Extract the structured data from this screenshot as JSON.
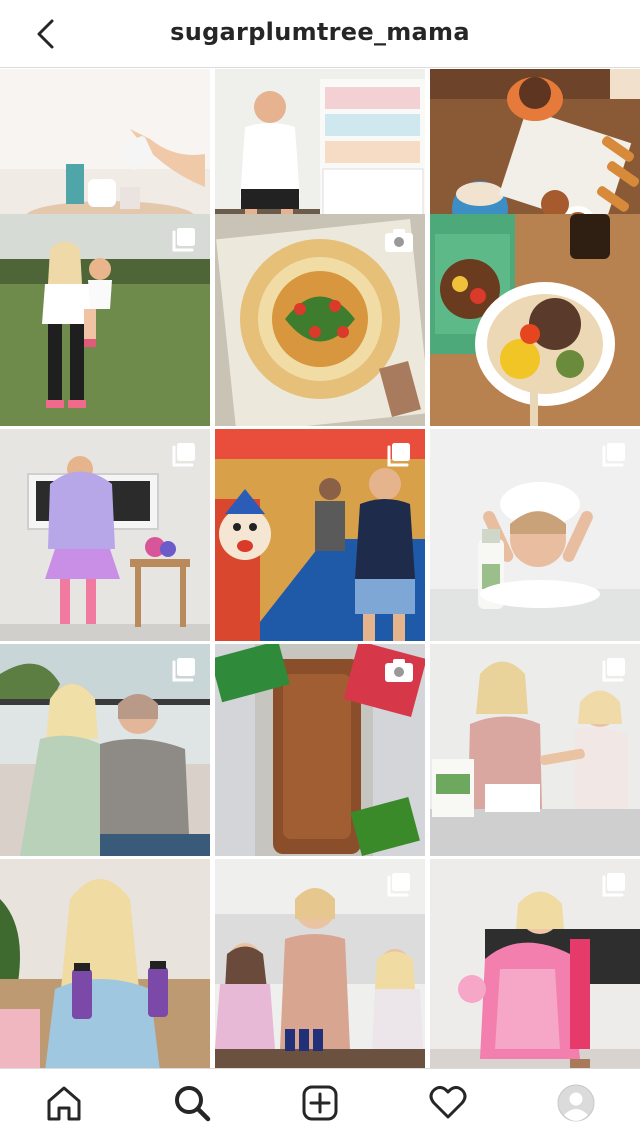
{
  "header": {
    "username": "sugarplumtree_mama",
    "back_icon": "chevron-left-icon"
  },
  "grid": {
    "posts": [
      {
        "id": "p1",
        "scene": "salon",
        "badge": null
      },
      {
        "id": "p2",
        "scene": "nursery",
        "badge": null
      },
      {
        "id": "p3",
        "scene": "cafe",
        "badge": null
      },
      {
        "id": "p4",
        "scene": "park",
        "badge": "carousel"
      },
      {
        "id": "p5",
        "scene": "pizza",
        "badge": "video"
      },
      {
        "id": "p6",
        "scene": "bowl",
        "badge": null
      },
      {
        "id": "p7",
        "scene": "costume",
        "badge": "carousel"
      },
      {
        "id": "p8",
        "scene": "arcade",
        "badge": "carousel"
      },
      {
        "id": "p9",
        "scene": "bath",
        "badge": "carousel"
      },
      {
        "id": "p10",
        "scene": "balcony",
        "badge": "carousel"
      },
      {
        "id": "p11",
        "scene": "board",
        "badge": "video"
      },
      {
        "id": "p12",
        "scene": "kitchen",
        "badge": "carousel"
      },
      {
        "id": "p13",
        "scene": "bottles",
        "badge": null
      },
      {
        "id": "p14",
        "scene": "family",
        "badge": "carousel"
      },
      {
        "id": "p15",
        "scene": "backpack",
        "badge": "carousel"
      }
    ]
  },
  "tabbar": {
    "tabs": [
      {
        "name": "home",
        "icon": "home-icon"
      },
      {
        "name": "search",
        "icon": "search-icon",
        "active": true
      },
      {
        "name": "new-post",
        "icon": "plus-square-icon"
      },
      {
        "name": "activity",
        "icon": "heart-icon"
      },
      {
        "name": "profile",
        "icon": "avatar-icon"
      }
    ]
  },
  "colors": {
    "text": "#262626",
    "border": "#dbdbdb",
    "background": "#ffffff"
  }
}
